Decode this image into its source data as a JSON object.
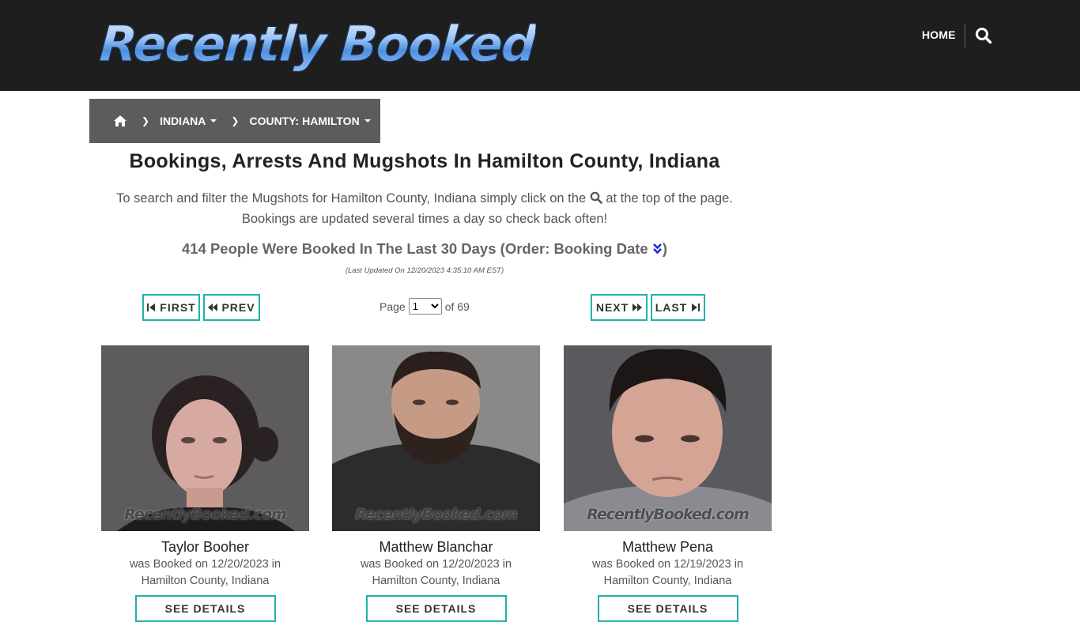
{
  "site": {
    "logo_text": "Recently Booked"
  },
  "nav": {
    "home_label": "HOME",
    "search_icon": "search-icon"
  },
  "breadcrumb": {
    "home_icon": "home-icon",
    "state_label": "INDIANA",
    "county_label": "COUNTY: HAMILTON"
  },
  "main": {
    "title": "Bookings, Arrests And Mugshots In Hamilton County, Indiana",
    "desc_part1": "To search and filter the Mugshots for Hamilton County, Indiana simply click on the",
    "desc_part2": "at the top of the page.",
    "desc_line2": "Bookings are updated several times a day so check back often!",
    "count_text": "414 People Were Booked In The Last 30 Days (Order: Booking Date",
    "count_close": ")",
    "last_updated": "(Last Updated On 12/20/2023 4:35:10 AM EST)"
  },
  "pagination": {
    "first_label": "FIRST",
    "prev_label": "PREV",
    "next_label": "NEXT",
    "last_label": "LAST",
    "page_label": "Page",
    "current_page": "1",
    "of_label": "of 69"
  },
  "watermark": "RecentlyBooked.com",
  "bookings": [
    {
      "name": "Taylor Booher",
      "line1": "was Booked on 12/20/2023 in",
      "line2": "Hamilton County, Indiana",
      "details_label": "SEE DETAILS"
    },
    {
      "name": "Matthew Blanchar",
      "line1": "was Booked on 12/20/2023 in",
      "line2": "Hamilton County, Indiana",
      "details_label": "SEE DETAILS"
    },
    {
      "name": "Matthew Pena",
      "line1": "was Booked on 12/19/2023 in",
      "line2": "Hamilton County, Indiana",
      "details_label": "SEE DETAILS"
    }
  ],
  "colors": {
    "header_bg": "#1e1e1e",
    "accent": "#20b2aa",
    "breadcrumb_bg": "#5c5c5c"
  }
}
